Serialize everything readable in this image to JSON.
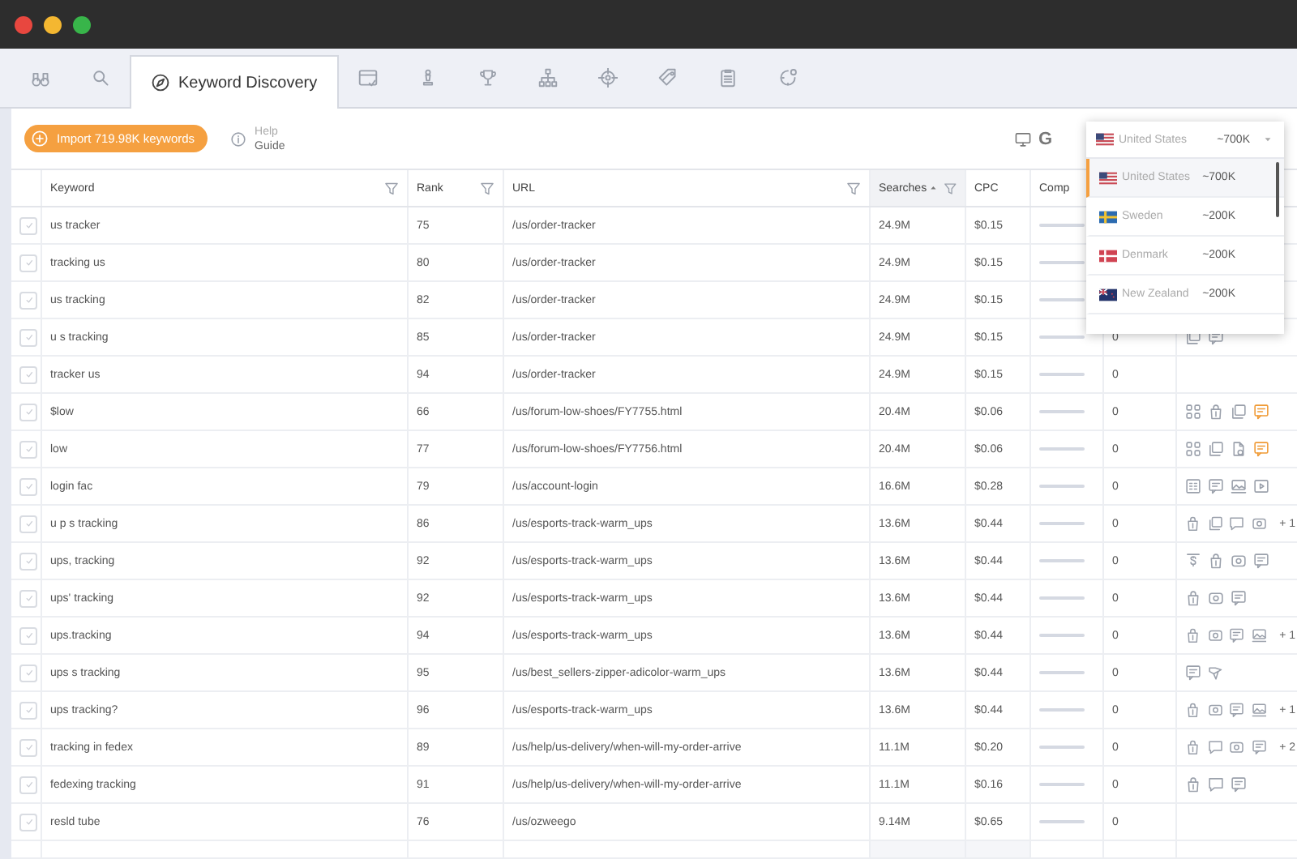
{
  "tabs": [
    {
      "kind": "binoculars",
      "selected": false
    },
    {
      "kind": "search",
      "selected": false
    },
    {
      "kind": "compass",
      "label": "Keyword Discovery",
      "selected": true
    },
    {
      "kind": "browser",
      "selected": false
    },
    {
      "kind": "chess",
      "selected": false
    },
    {
      "kind": "trophy",
      "selected": false
    },
    {
      "kind": "hierarchy",
      "selected": false
    },
    {
      "kind": "target",
      "selected": false
    },
    {
      "kind": "tag",
      "selected": false
    },
    {
      "kind": "clipboard",
      "selected": false
    },
    {
      "kind": "gear",
      "selected": false
    }
  ],
  "toolbar": {
    "import_button": "Import 719.98K keywords",
    "help": {
      "title": "Help",
      "link": "Guide"
    },
    "engine_logo": "G"
  },
  "country_dropdown": {
    "current": {
      "kind": "us",
      "country": "United States",
      "volume": "~700K"
    },
    "options": [
      {
        "kind": "us",
        "country": "United States",
        "volume": "~700K",
        "selected": true
      },
      {
        "kind": "se",
        "country": "Sweden",
        "volume": "~200K",
        "selected": false
      },
      {
        "kind": "dk",
        "country": "Denmark",
        "volume": "~200K",
        "selected": false
      },
      {
        "kind": "nz",
        "country": "New Zealand",
        "volume": "~200K",
        "selected": false
      }
    ]
  },
  "table": {
    "columns": [
      {
        "label": "Keyword",
        "filter": true,
        "sorted": false
      },
      {
        "label": "Rank",
        "filter": true,
        "sorted": false
      },
      {
        "label": "URL",
        "filter": true,
        "sorted": false
      },
      {
        "label": "Searches",
        "filter": true,
        "sorted": true
      },
      {
        "label": "CPC",
        "filter": false,
        "sorted": false
      },
      {
        "label": "Comp",
        "filter": false,
        "sorted": false
      }
    ],
    "rows": [
      {
        "checked": false,
        "keyword": "us tracker",
        "rank": "75",
        "url": "/us/order-tracker",
        "searches": "24.9M",
        "cpc": "$0.15"
      },
      {
        "checked": false,
        "keyword": "tracking us",
        "rank": "80",
        "url": "/us/order-tracker",
        "searches": "24.9M",
        "cpc": "$0.15"
      },
      {
        "checked": false,
        "keyword": "us tracking",
        "rank": "82",
        "url": "/us/order-tracker",
        "searches": "24.9M",
        "cpc": "$0.15"
      },
      {
        "checked": false,
        "keyword": "u s tracking",
        "rank": "85",
        "url": "/us/order-tracker",
        "searches": "24.9M",
        "cpc": "$0.15",
        "column_8": "0",
        "features": [
          {
            "kind": "copy",
            "highlighted": false
          },
          {
            "kind": "note",
            "highlighted": false
          }
        ]
      },
      {
        "checked": false,
        "keyword": "tracker us",
        "rank": "94",
        "url": "/us/order-tracker",
        "searches": "24.9M",
        "cpc": "$0.15",
        "column_8": "0"
      },
      {
        "checked": false,
        "keyword": "$low",
        "rank": "66",
        "url": "/us/forum-low-shoes/FY7755.html",
        "searches": "20.4M",
        "cpc": "$0.06",
        "column_8": "0",
        "popped": true,
        "features": [
          {
            "kind": "grid",
            "highlighted": false
          },
          {
            "kind": "bag",
            "highlighted": false
          },
          {
            "kind": "copy",
            "highlighted": false
          },
          {
            "kind": "note",
            "highlighted": true
          }
        ]
      },
      {
        "checked": false,
        "keyword": "low",
        "rank": "77",
        "url": "/us/forum-low-shoes/FY7756.html",
        "searches": "20.4M",
        "cpc": "$0.06",
        "column_8": "0",
        "popped": true,
        "features": [
          {
            "kind": "grid",
            "highlighted": false
          },
          {
            "kind": "copy",
            "highlighted": false
          },
          {
            "kind": "doc",
            "highlighted": false
          },
          {
            "kind": "note",
            "highlighted": true
          }
        ]
      },
      {
        "checked": false,
        "keyword": "login fac",
        "rank": "79",
        "url": "/us/account-login",
        "searches": "16.6M",
        "cpc": "$0.28",
        "column_8": "0",
        "features": [
          {
            "kind": "list",
            "highlighted": false
          },
          {
            "kind": "note",
            "highlighted": false
          },
          {
            "kind": "image",
            "highlighted": false
          },
          {
            "kind": "video",
            "highlighted": false
          }
        ]
      },
      {
        "checked": false,
        "keyword": "u p s tracking",
        "rank": "86",
        "url": "/us/esports-track-warm_ups",
        "searches": "13.6M",
        "cpc": "$0.44",
        "column_8": "0",
        "features": [
          {
            "kind": "bag",
            "highlighted": false
          },
          {
            "kind": "copy",
            "highlighted": false
          },
          {
            "kind": "chat",
            "highlighted": false
          },
          {
            "kind": "camera",
            "highlighted": false
          }
        ],
        "more": "+ 1"
      },
      {
        "checked": false,
        "keyword": "ups, tracking",
        "rank": "92",
        "url": "/us/esports-track-warm_ups",
        "searches": "13.6M",
        "cpc": "$0.44",
        "column_8": "0",
        "features": [
          {
            "kind": "dollar",
            "highlighted": false
          },
          {
            "kind": "bag",
            "highlighted": false
          },
          {
            "kind": "camera",
            "highlighted": false
          },
          {
            "kind": "note",
            "highlighted": false
          }
        ]
      },
      {
        "checked": false,
        "keyword": "ups' tracking",
        "rank": "92",
        "url": "/us/esports-track-warm_ups",
        "searches": "13.6M",
        "cpc": "$0.44",
        "column_8": "0",
        "features": [
          {
            "kind": "bag",
            "highlighted": false
          },
          {
            "kind": "camera",
            "highlighted": false
          },
          {
            "kind": "note",
            "highlighted": false
          }
        ]
      },
      {
        "checked": false,
        "keyword": "ups.tracking",
        "rank": "94",
        "url": "/us/esports-track-warm_ups",
        "searches": "13.6M",
        "cpc": "$0.44",
        "column_8": "0",
        "features": [
          {
            "kind": "bag",
            "highlighted": false
          },
          {
            "kind": "camera",
            "highlighted": false
          },
          {
            "kind": "note",
            "highlighted": false
          },
          {
            "kind": "image",
            "highlighted": false
          }
        ],
        "more": "+ 1"
      },
      {
        "checked": false,
        "keyword": "ups s tracking",
        "rank": "95",
        "url": "/us/best_sellers-zipper-adicolor-warm_ups",
        "searches": "13.6M",
        "cpc": "$0.44",
        "column_8": "0",
        "features": [
          {
            "kind": "note",
            "highlighted": false
          },
          {
            "kind": "star",
            "highlighted": false
          }
        ]
      },
      {
        "checked": false,
        "keyword": "ups tracking?",
        "rank": "96",
        "url": "/us/esports-track-warm_ups",
        "searches": "13.6M",
        "cpc": "$0.44",
        "column_8": "0",
        "features": [
          {
            "kind": "bag",
            "highlighted": false
          },
          {
            "kind": "camera",
            "highlighted": false
          },
          {
            "kind": "note",
            "highlighted": false
          },
          {
            "kind": "image",
            "highlighted": false
          }
        ],
        "more": "+ 1"
      },
      {
        "checked": false,
        "keyword": "tracking in fedex",
        "rank": "89",
        "url": "/us/help/us-delivery/when-will-my-order-arrive",
        "searches": "11.1M",
        "cpc": "$0.20",
        "column_8": "0",
        "features": [
          {
            "kind": "bag",
            "highlighted": false
          },
          {
            "kind": "chat",
            "highlighted": false
          },
          {
            "kind": "camera",
            "highlighted": false
          },
          {
            "kind": "note",
            "highlighted": false
          }
        ],
        "more": "+ 2"
      },
      {
        "checked": false,
        "keyword": "fedexing tracking",
        "rank": "91",
        "url": "/us/help/us-delivery/when-will-my-order-arrive",
        "searches": "11.1M",
        "cpc": "$0.16",
        "column_8": "0",
        "features": [
          {
            "kind": "bag",
            "highlighted": false
          },
          {
            "kind": "chat",
            "highlighted": false
          },
          {
            "kind": "note",
            "highlighted": false
          }
        ]
      },
      {
        "checked": false,
        "keyword": "resld tube",
        "rank": "76",
        "url": "/us/ozweego",
        "searches": "9.14M",
        "cpc": "$0.65",
        "column_8": "0",
        "lifted": true
      }
    ]
  }
}
